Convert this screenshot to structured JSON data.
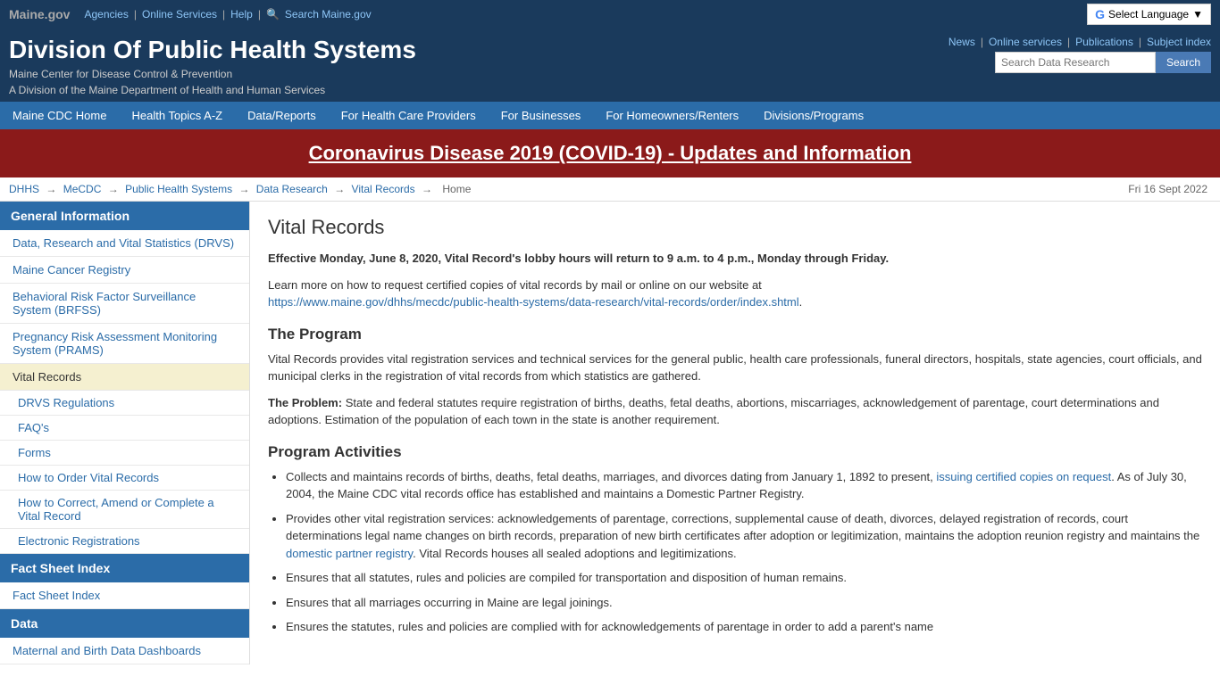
{
  "topbar": {
    "maine_gov": "Maine.gov",
    "agencies": "Agencies",
    "online_services": "Online Services",
    "help": "Help",
    "search_maine": "Search Maine.gov",
    "select_language": "Select Language"
  },
  "header": {
    "title": "Division Of Public Health Systems",
    "subtitle1": "Maine Center for Disease Control & Prevention",
    "subtitle2": "A Division of the Maine Department of Health and Human Services",
    "links": [
      "News",
      "Online services",
      "Publications",
      "Subject index"
    ],
    "search_placeholder": "Search Data Research",
    "search_button": "Search"
  },
  "navbar": {
    "items": [
      "Maine CDC Home",
      "Health Topics A-Z",
      "Data/Reports",
      "For Health Care Providers",
      "For Businesses",
      "For Homeowners/Renters",
      "Divisions/Programs"
    ]
  },
  "covid_banner": {
    "text": "Coronavirus Disease 2019 (COVID-19) - Updates and Information",
    "href": "#"
  },
  "breadcrumb": {
    "items": [
      "DHHS",
      "MeCDC",
      "Public Health Systems",
      "Data Research",
      "Vital Records",
      "Home"
    ],
    "date": "Fri 16 Sept 2022"
  },
  "sidebar": {
    "sections": [
      {
        "header": "General Information",
        "items": [
          {
            "label": "Data, Research and Vital Statistics (DRVS)",
            "sub": false,
            "active": false
          },
          {
            "label": "Maine Cancer Registry",
            "sub": false,
            "active": false
          },
          {
            "label": "Behavioral Risk Factor Surveillance System (BRFSS)",
            "sub": false,
            "active": false
          },
          {
            "label": "Pregnancy Risk Assessment Monitoring System (PRAMS)",
            "sub": false,
            "active": false
          },
          {
            "label": "Vital Records",
            "sub": false,
            "active": true
          },
          {
            "label": "DRVS Regulations",
            "sub": true,
            "active": false
          },
          {
            "label": "FAQ's",
            "sub": true,
            "active": false
          },
          {
            "label": "Forms",
            "sub": true,
            "active": false
          },
          {
            "label": "How to Order Vital Records",
            "sub": true,
            "active": false
          },
          {
            "label": "How to Correct, Amend or Complete a Vital Record",
            "sub": true,
            "active": false
          },
          {
            "label": "Electronic Registrations",
            "sub": true,
            "active": false
          }
        ]
      },
      {
        "header": "Fact Sheet Index",
        "items": [
          {
            "label": "Fact Sheet Index",
            "sub": false,
            "active": false
          }
        ]
      },
      {
        "header": "Data",
        "items": [
          {
            "label": "Maternal and Birth Data Dashboards",
            "sub": false,
            "active": false
          }
        ]
      }
    ]
  },
  "content": {
    "title": "Vital Records",
    "notice": "Effective Monday, June 8, 2020, Vital Record's lobby hours will return to 9 a.m. to 4 p.m., Monday through Friday.",
    "intro": "Learn more on how to request certified copies of vital records by mail or online on our website at",
    "intro_link": "https://www.maine.gov/dhhs/mecdc/public-health-systems/data-research/vital-records/order/index.shtml",
    "program_heading": "The Program",
    "program_text": "Vital Records provides vital registration services and technical services for the general public, health care professionals, funeral directors, hospitals, state agencies, court officials, and municipal clerks in the registration of vital records from which statistics are gathered.",
    "problem_label": "The Problem:",
    "problem_text": " State and federal statutes require registration of births, deaths, fetal deaths, abortions, miscarriages, acknowledgement of parentage, court determinations and adoptions. Estimation of the population of each town in the state is another requirement.",
    "activities_heading": "Program Activities",
    "bullets": [
      {
        "text": "Collects and maintains records of births, deaths, fetal deaths, marriages, and divorces dating from January 1, 1892 to present, ",
        "link_text": "issuing certified copies on request",
        "link_href": "#",
        "text2": ". As of July 30, 2004, the Maine CDC vital records office has established and maintains a Domestic Partner Registry."
      },
      {
        "text": "Provides other vital registration services: acknowledgements of parentage, corrections, supplemental cause of death, divorces, delayed registration of records, court determinations legal name changes on birth records, preparation of new birth certificates after adoption or legitimization, maintains the adoption reunion registry and maintains the ",
        "link_text": "domestic partner registry",
        "link_href": "#",
        "text2": ". Vital Records houses all sealed adoptions and legitimizations."
      },
      {
        "text": "Ensures that all statutes, rules and policies are compiled for transportation and disposition of human remains.",
        "link_text": "",
        "link_href": "",
        "text2": ""
      },
      {
        "text": "Ensures that all marriages occurring in Maine are legal joinings.",
        "link_text": "",
        "link_href": "",
        "text2": ""
      },
      {
        "text": "Ensures the statutes, rules and policies are complied with for acknowledgements of parentage in order to add a parent's name",
        "link_text": "",
        "link_href": "",
        "text2": ""
      }
    ]
  }
}
